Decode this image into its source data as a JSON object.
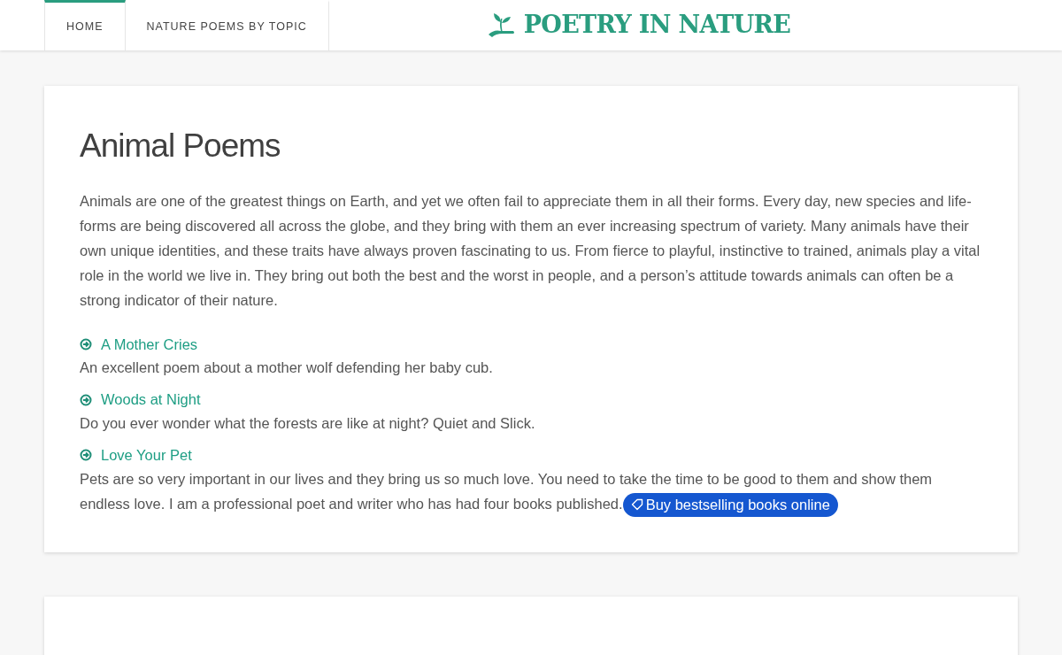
{
  "nav": {
    "tabs": [
      {
        "label": "HOME",
        "selected": true
      },
      {
        "label": "NATURE POEMS BY TOPIC",
        "selected": false
      }
    ]
  },
  "logo": {
    "text": "POETRY IN NATURE"
  },
  "article": {
    "title": "Animal Poems",
    "intro": "Animals are one of the greatest things on Earth, and yet we often fail to appreciate them in all their forms. Every day, new species and life-forms are being discovered all across the globe, and they bring with them an ever increasing spectrum of variety. Many animals have their own unique identities, and these traits have always proven fascinating to us. From fierce to playful, instinctive to trained, animals play a vital role in the world we live in. They bring out both the best and the worst in people, and a person’s attitude towards animals can often be a strong indicator of their nature.",
    "poems": [
      {
        "title": "A Mother Cries",
        "description": "An excellent poem about a mother wolf defending her baby cub."
      },
      {
        "title": "Woods at Night",
        "description": "Do you ever wonder what the forests are like at night? Quiet and Slick."
      },
      {
        "title": "Love Your Pet",
        "description": "Pets are so very important in our lives and they bring us so much love. You need to take the time to be good to them and show them endless love. I am a professional poet and writer who has had four books published.",
        "ad_link": "Buy bestselling books online"
      }
    ]
  }
}
